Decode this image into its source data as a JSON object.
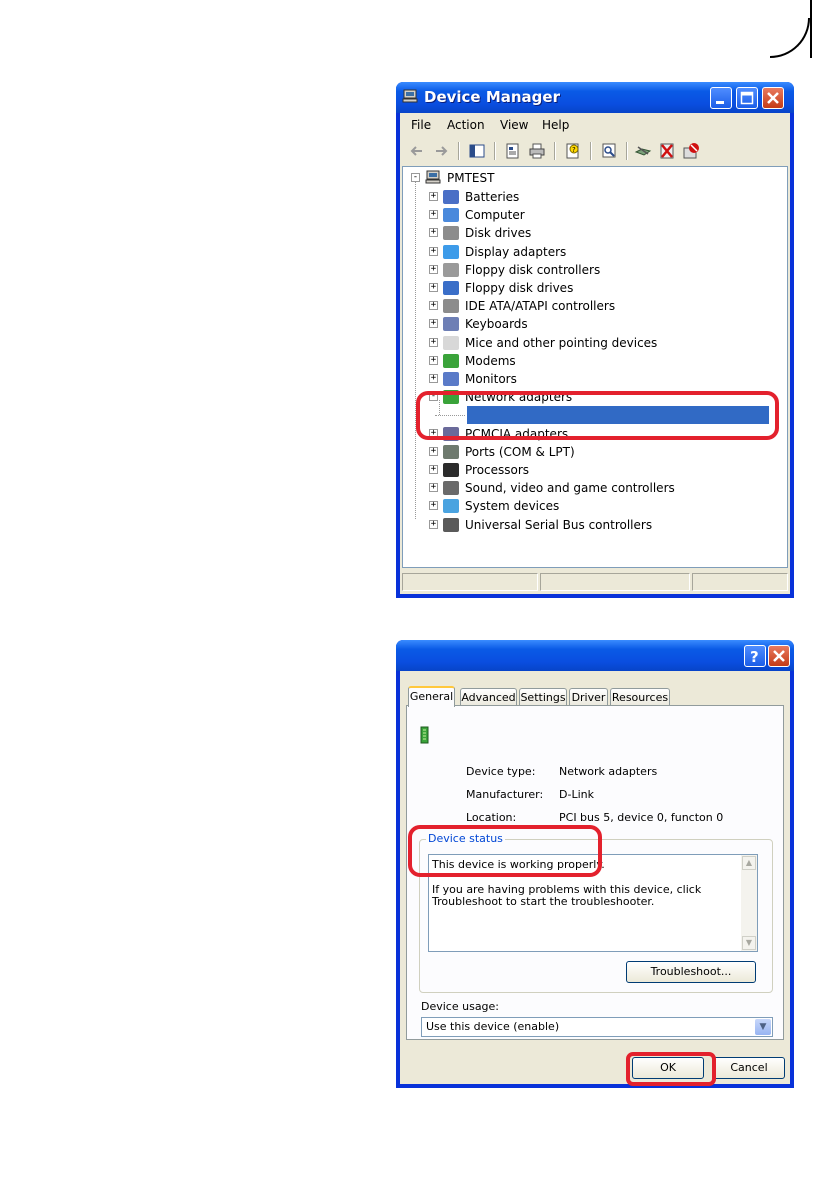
{
  "device_manager": {
    "title": "Device Manager",
    "menu": [
      "File",
      "Action",
      "View",
      "Help"
    ],
    "toolbar_icons": [
      "back-arrow-icon",
      "forward-arrow-icon",
      "show-hide-tree-icon",
      "properties-icon",
      "print-icon",
      "help-icon",
      "scan-hardware-icon",
      "update-driver-icon",
      "disable-device-icon",
      "uninstall-icon"
    ],
    "root": "PMTEST",
    "categories": [
      {
        "label": "Batteries",
        "expanded": false
      },
      {
        "label": "Computer",
        "expanded": false
      },
      {
        "label": "Disk drives",
        "expanded": false
      },
      {
        "label": "Display adapters",
        "expanded": false
      },
      {
        "label": "Floppy disk controllers",
        "expanded": false
      },
      {
        "label": "Floppy disk drives",
        "expanded": false
      },
      {
        "label": "IDE ATA/ATAPI controllers",
        "expanded": false
      },
      {
        "label": "Keyboards",
        "expanded": false
      },
      {
        "label": "Mice and other pointing devices",
        "expanded": false
      },
      {
        "label": "Modems",
        "expanded": false
      },
      {
        "label": "Monitors",
        "expanded": false
      },
      {
        "label": "Network adapters",
        "expanded": true
      },
      {
        "label": "",
        "selected": true
      },
      {
        "label": "PCMCIA adapters",
        "expanded": false
      },
      {
        "label": "Ports (COM & LPT)",
        "expanded": false
      },
      {
        "label": "Processors",
        "expanded": false
      },
      {
        "label": "Sound, video and game controllers",
        "expanded": false
      },
      {
        "label": "System devices",
        "expanded": false
      },
      {
        "label": "Universal Serial Bus controllers",
        "expanded": false
      }
    ],
    "highlight_color": "#e3212d",
    "selection_color": "#316ac5"
  },
  "properties_dialog": {
    "tabs": [
      "General",
      "Advanced",
      "Settings",
      "Driver",
      "Resources"
    ],
    "active_tab": "General",
    "device_type_label": "Device type:",
    "device_type_value": "Network adapters",
    "manufacturer_label": "Manufacturer:",
    "manufacturer_value": "D-Link",
    "location_label": "Location:",
    "location_value": "PCI bus 5, device 0, functon 0",
    "device_status_legend": "Device status",
    "status_line1": "This device is working properly.",
    "status_line2": "If you are having problems with this device, click Troubleshoot to start the troubleshooter.",
    "troubleshoot_button": "Troubleshoot...",
    "device_usage_label": "Device usage:",
    "device_usage_value": "Use this device (enable)",
    "ok_button": "OK",
    "cancel_button": "Cancel"
  }
}
